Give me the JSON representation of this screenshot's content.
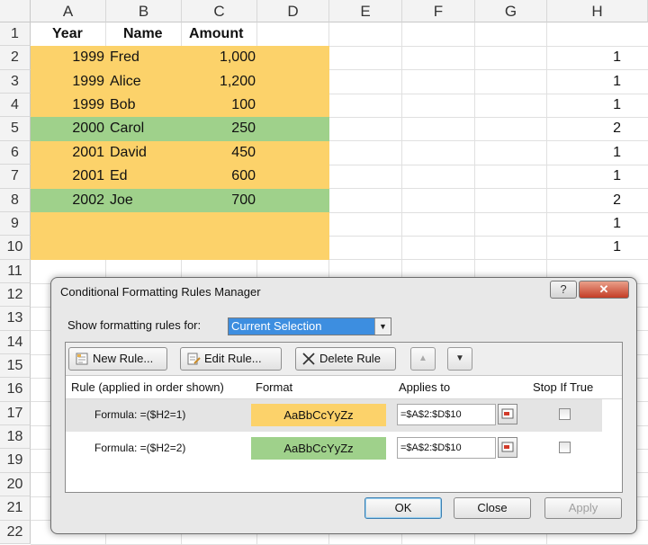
{
  "columns": [
    "A",
    "B",
    "C",
    "D",
    "E",
    "F",
    "G",
    "H"
  ],
  "rows": [
    "1",
    "2",
    "3",
    "4",
    "5",
    "6",
    "7",
    "8",
    "9",
    "10",
    "11",
    "12",
    "13",
    "14",
    "15",
    "16",
    "17",
    "18",
    "19",
    "20",
    "21",
    "22"
  ],
  "headers": {
    "year": "Year",
    "name": "Name",
    "amount": "Amount"
  },
  "data": [
    {
      "year": "1999",
      "name": "Fred",
      "amount": "1,000",
      "h": "1"
    },
    {
      "year": "1999",
      "name": "Alice",
      "amount": "1,200",
      "h": "1"
    },
    {
      "year": "1999",
      "name": "Bob",
      "amount": "100",
      "h": "1"
    },
    {
      "year": "2000",
      "name": "Carol",
      "amount": "250",
      "h": "2"
    },
    {
      "year": "2001",
      "name": "David",
      "amount": "450",
      "h": "1"
    },
    {
      "year": "2001",
      "name": "Ed",
      "amount": "600",
      "h": "1"
    },
    {
      "year": "2002",
      "name": "Joe",
      "amount": "700",
      "h": "2"
    },
    {
      "year": "",
      "name": "",
      "amount": "",
      "h": "1"
    },
    {
      "year": "",
      "name": "",
      "amount": "",
      "h": "1"
    }
  ],
  "colors": {
    "orange": "#fcd26a",
    "green": "#9fd18b"
  },
  "dialog": {
    "title": "Conditional Formatting Rules Manager",
    "help": "?",
    "close": "✕",
    "show_label": "Show formatting rules for:",
    "show_value": "Current Selection",
    "new_rule": "New Rule...",
    "edit_rule": "Edit Rule...",
    "delete_rule": "Delete Rule",
    "col_rule": "Rule (applied in order shown)",
    "col_format": "Format",
    "col_applies": "Applies to",
    "col_stop": "Stop If True",
    "rules": [
      {
        "formula": "Formula: =($H2=1)",
        "preview": "AaBbCcYyZz",
        "applies": "=$A$2:$D$10"
      },
      {
        "formula": "Formula: =($H2=2)",
        "preview": "AaBbCcYyZz",
        "applies": "=$A$2:$D$10"
      }
    ],
    "ok": "OK",
    "close_btn": "Close",
    "apply": "Apply"
  }
}
